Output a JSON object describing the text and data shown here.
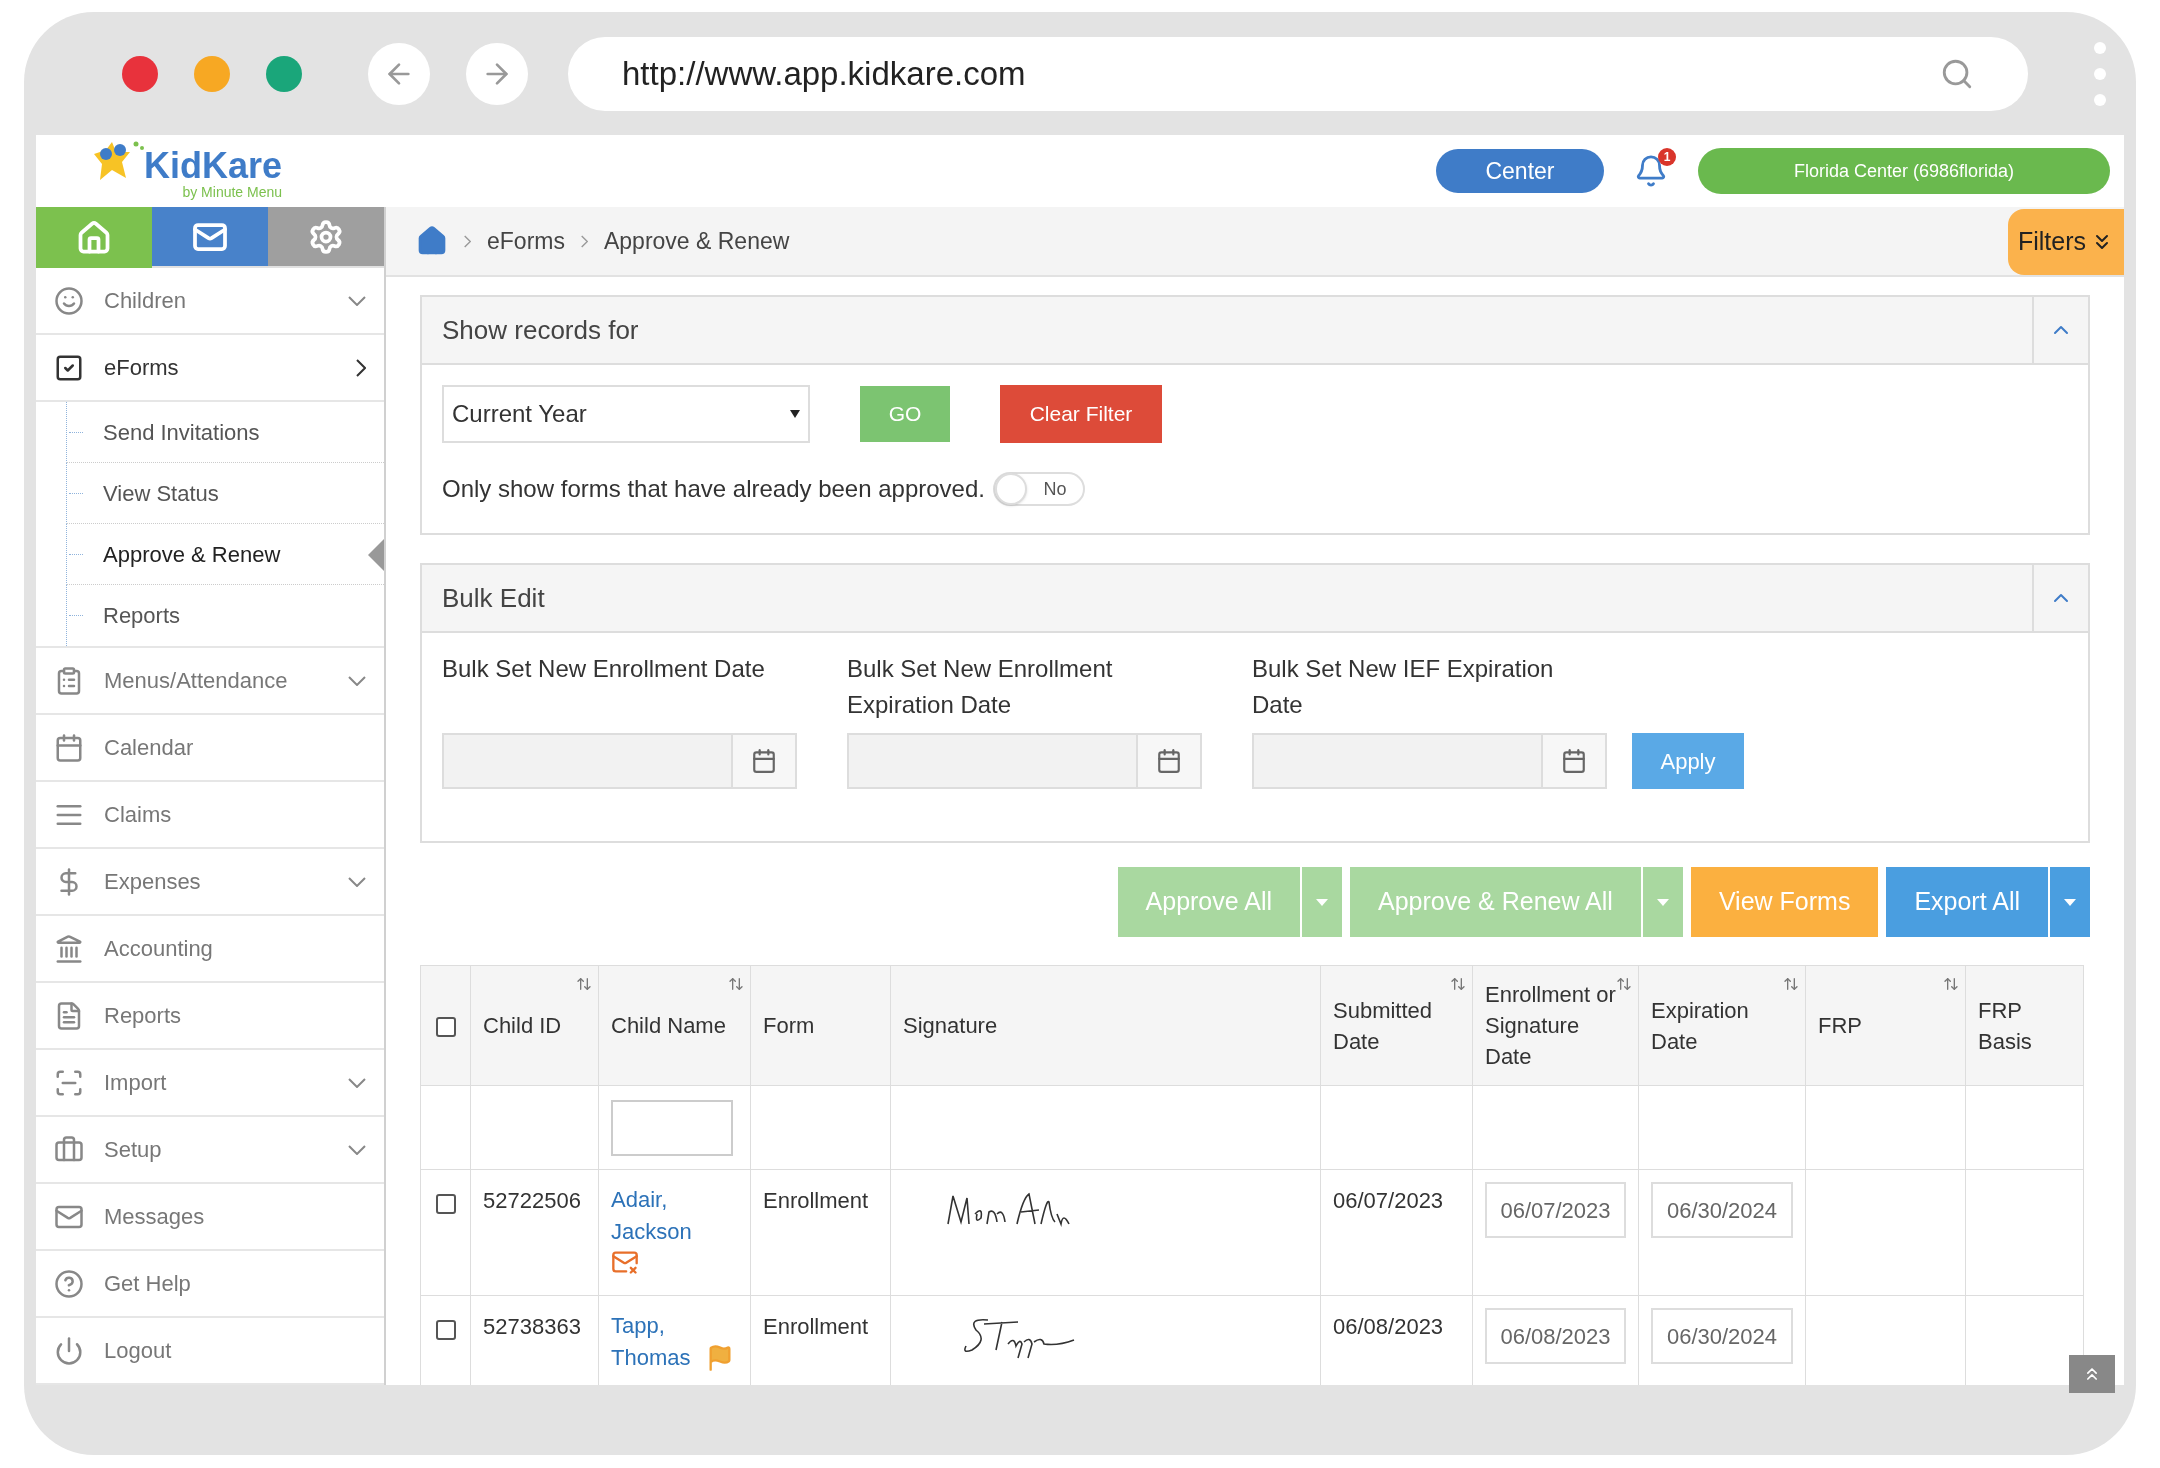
{
  "browser": {
    "url": "http://www.app.kidkare.com"
  },
  "header": {
    "logo_text": "KidKare",
    "logo_sub": "by Minute Menu",
    "center_button": "Center",
    "notification_count": "1",
    "account_button": "Florida Center (6986florida)"
  },
  "sidebar": {
    "tabs": [
      {
        "selected": true
      },
      {
        "selected": false
      },
      {
        "selected": false
      }
    ],
    "items": [
      {
        "label": "Children",
        "kind": "group",
        "expanded": false
      },
      {
        "label": "eForms",
        "kind": "group",
        "expanded": true,
        "children": [
          {
            "label": "Send Invitations",
            "selected": false
          },
          {
            "label": "View Status",
            "selected": false
          },
          {
            "label": "Approve & Renew",
            "selected": true
          },
          {
            "label": "Reports",
            "selected": false
          }
        ]
      },
      {
        "label": "Menus/Attendance",
        "kind": "group",
        "expanded": false
      },
      {
        "label": "Calendar",
        "kind": "link"
      },
      {
        "label": "Claims",
        "kind": "link"
      },
      {
        "label": "Expenses",
        "kind": "group",
        "expanded": false
      },
      {
        "label": "Accounting",
        "kind": "link"
      },
      {
        "label": "Reports",
        "kind": "link"
      },
      {
        "label": "Import",
        "kind": "group",
        "expanded": false
      },
      {
        "label": "Setup",
        "kind": "group",
        "expanded": false
      },
      {
        "label": "Messages",
        "kind": "link"
      },
      {
        "label": "Get Help",
        "kind": "link"
      },
      {
        "label": "Logout",
        "kind": "link"
      }
    ]
  },
  "breadcrumb": [
    "eForms",
    "Approve & Renew"
  ],
  "filters_button": "Filters",
  "show_records": {
    "title": "Show records for",
    "expanded": true,
    "period": "Current Year",
    "go": "GO",
    "clear": "Clear Filter",
    "toggle_label": "Only show forms that have already been approved.",
    "toggle_on": false,
    "toggle_text": "No"
  },
  "bulk_edit": {
    "title": "Bulk Edit",
    "expanded": true,
    "fields": [
      {
        "label": "Bulk Set New Enrollment Date"
      },
      {
        "label": "Bulk Set New Enrollment Expiration Date"
      },
      {
        "label": "Bulk Set New IEF Expiration Date"
      }
    ],
    "apply": "Apply"
  },
  "actions": [
    {
      "label": "Approve All",
      "kind": "green",
      "disabled": true,
      "split": true
    },
    {
      "label": "Approve & Renew All",
      "kind": "green",
      "disabled": true,
      "split": true
    },
    {
      "label": "View Forms",
      "kind": "orange",
      "disabled": false,
      "split": false
    },
    {
      "label": "Export All",
      "kind": "blue",
      "disabled": false,
      "split": true
    }
  ],
  "table": {
    "all_checked": false,
    "columns": [
      {
        "label": "Child ID",
        "sortable": true
      },
      {
        "label": "Child Name",
        "sortable": true
      },
      {
        "label": "Form",
        "sortable": false
      },
      {
        "label": "Signature",
        "sortable": false
      },
      {
        "label": "Submitted Date",
        "sortable": true
      },
      {
        "label": "Enrollment or Signature Date",
        "sortable": true
      },
      {
        "label": "Expiration Date",
        "sortable": true
      },
      {
        "label": "FRP",
        "sortable": true
      },
      {
        "label": "FRP Basis",
        "sortable": false
      }
    ],
    "rows": [
      {
        "checked": false,
        "child_id": "52722506",
        "child_name": "Adair, Jackson",
        "form": "Enrollment",
        "submitted": "06/07/2023",
        "enrollment_date": "06/07/2023",
        "expiration_date": "06/30/2024"
      },
      {
        "checked": false,
        "child_id": "52738363",
        "child_name": "Tapp, Thomas",
        "form": "Enrollment",
        "submitted": "06/08/2023",
        "enrollment_date": "06/08/2023",
        "expiration_date": "06/30/2024"
      }
    ]
  }
}
